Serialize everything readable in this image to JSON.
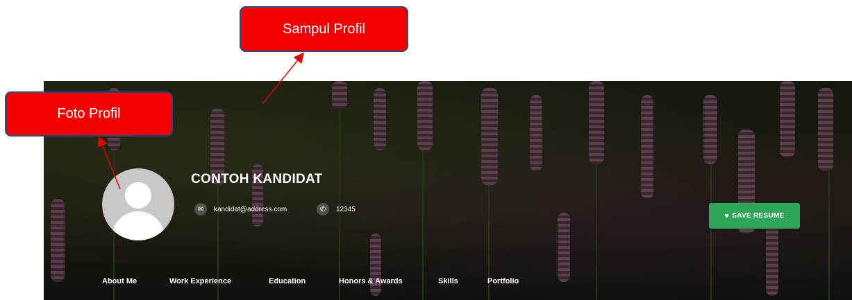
{
  "profile": {
    "name": "CONTOH KANDIDAT",
    "email": "kandidat@address.com",
    "phone": "12345"
  },
  "icons": {
    "email": "envelope-icon",
    "phone": "phone-icon",
    "save": "heart-icon",
    "avatar": "user-placeholder-icon"
  },
  "actions": {
    "save_resume": "SAVE RESUME"
  },
  "nav": [
    "About Me",
    "Work Experience",
    "Education",
    "Honors & Awards",
    "Skills",
    "Portfolio"
  ],
  "annotations": {
    "cover_label": "Sampul Profil",
    "photo_label": "Foto Profil"
  },
  "colors": {
    "save_button": "#2ea65a",
    "callout_fill": "#f20000",
    "callout_border": "#2e4675",
    "arrow": "#e00000"
  }
}
